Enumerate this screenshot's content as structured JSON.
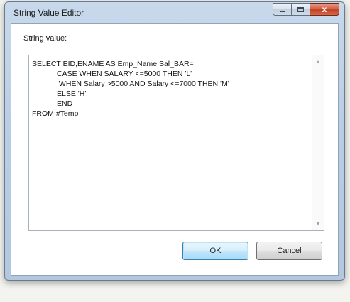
{
  "window": {
    "title": "String Value Editor",
    "minimize_glyph": "minimize-icon",
    "maximize_glyph": "maximize-icon",
    "close_glyph": "x"
  },
  "editor": {
    "label": "String value:",
    "lines": [
      "SELECT EID,ENAME AS Emp_Name,Sal_BAR=",
      "            CASE WHEN SALARY <=5000 THEN 'L'",
      "             WHEN Salary >5000 AND Salary <=7000 THEN 'M'",
      "            ELSE 'H'",
      "            END",
      "FROM #Temp"
    ]
  },
  "buttons": {
    "ok_label": "OK",
    "cancel_label": "Cancel"
  },
  "colors": {
    "frame": "#b9cde3",
    "close_button": "#c2401f",
    "default_button": "#bee6fd"
  }
}
